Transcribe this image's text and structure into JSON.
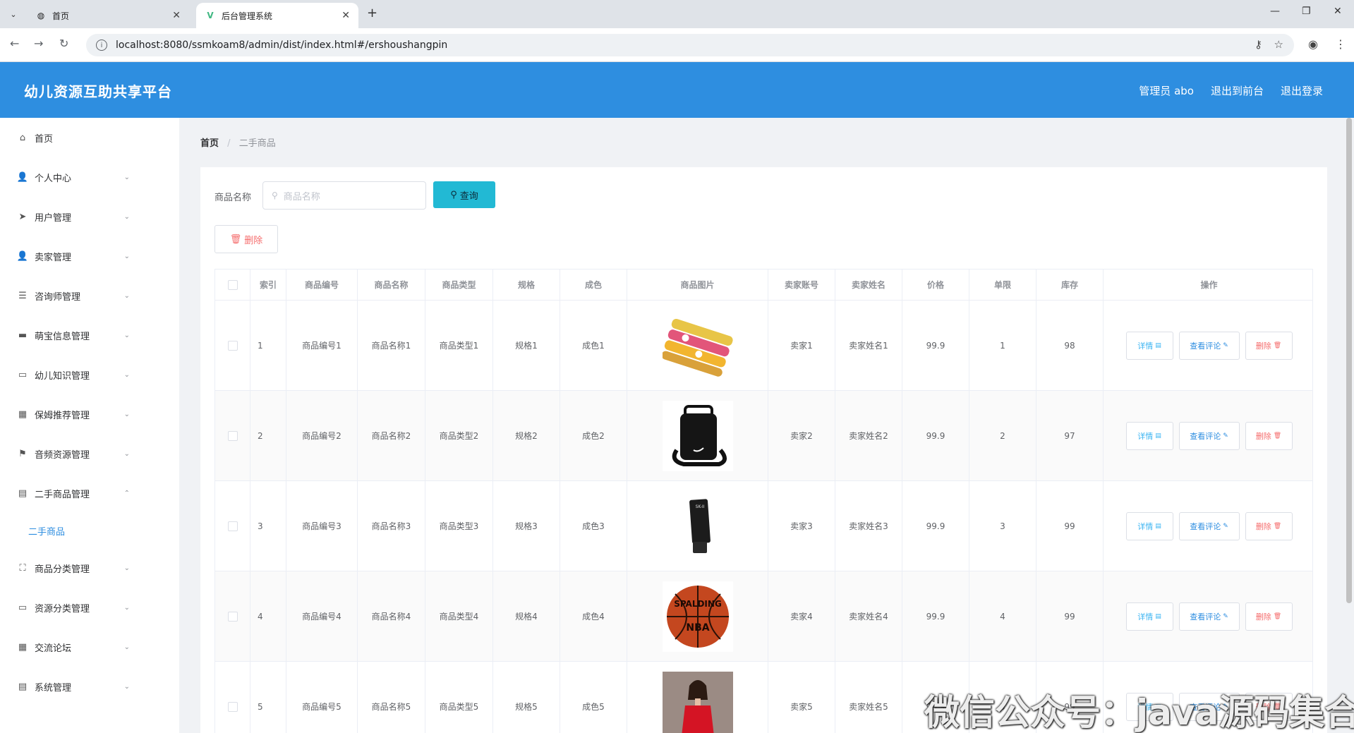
{
  "browser": {
    "tabs": [
      {
        "title": "首页"
      },
      {
        "title": "后台管理系统"
      }
    ],
    "url": "localhost:8080/ssmkoam8/admin/dist/index.html#/ershoushangpin"
  },
  "header": {
    "title": "幼儿资源互助共享平台",
    "admin_label": "管理员 abo",
    "to_front": "退出到前台",
    "logout": "退出登录",
    "color": "#2e8ee0"
  },
  "sidebar": {
    "items": [
      {
        "label": "首页",
        "icon": "home-icon",
        "glyph": "⌂",
        "expanded": false,
        "has_arrow": false
      },
      {
        "label": "个人中心",
        "icon": "user-icon",
        "glyph": "👤",
        "has_arrow": true
      },
      {
        "label": "用户管理",
        "icon": "send-icon",
        "glyph": "➤",
        "has_arrow": true
      },
      {
        "label": "卖家管理",
        "icon": "user-icon",
        "glyph": "👤",
        "has_arrow": true
      },
      {
        "label": "咨询师管理",
        "icon": "list-icon",
        "glyph": "☰",
        "has_arrow": true
      },
      {
        "label": "萌宝信息管理",
        "icon": "chat-icon",
        "glyph": "▬",
        "has_arrow": true
      },
      {
        "label": "幼儿知识管理",
        "icon": "monitor-icon",
        "glyph": "▭",
        "has_arrow": true
      },
      {
        "label": "保姆推荐管理",
        "icon": "grid-icon",
        "glyph": "▦",
        "has_arrow": true
      },
      {
        "label": "音频资源管理",
        "icon": "flag-icon",
        "glyph": "⚑",
        "has_arrow": true
      },
      {
        "label": "二手商品管理",
        "icon": "document-icon",
        "glyph": "▤",
        "has_arrow": true,
        "expanded": true
      },
      {
        "label": "商品分类管理",
        "icon": "fullscreen-icon",
        "glyph": "⛶",
        "has_arrow": true
      },
      {
        "label": "资源分类管理",
        "icon": "message-icon",
        "glyph": "▭",
        "has_arrow": true
      },
      {
        "label": "交流论坛",
        "icon": "menu-icon",
        "glyph": "▦",
        "has_arrow": true
      },
      {
        "label": "系统管理",
        "icon": "setting-icon",
        "glyph": "▤",
        "has_arrow": true
      }
    ],
    "active_sub": "二手商品"
  },
  "breadcrumb": {
    "home": "首页",
    "current": "二手商品"
  },
  "search": {
    "label": "商品名称",
    "placeholder": "商品名称",
    "button": "查询"
  },
  "toolbar": {
    "delete": "删除"
  },
  "table": {
    "headers": [
      "",
      "索引",
      "商品编号",
      "商品名称",
      "商品类型",
      "规格",
      "成色",
      "商品图片",
      "卖家账号",
      "卖家姓名",
      "价格",
      "单限",
      "库存",
      "操作"
    ],
    "rows": [
      {
        "index": "1",
        "code": "商品编号1",
        "name": "商品名称1",
        "type": "商品类型1",
        "spec": "规格1",
        "cond": "成色1",
        "image": "snack-tubes",
        "account": "卖家1",
        "seller": "卖家姓名1",
        "price": "99.9",
        "limit": "1",
        "stock": "98"
      },
      {
        "index": "2",
        "code": "商品编号2",
        "name": "商品名称2",
        "type": "商品类型2",
        "spec": "规格2",
        "cond": "成色2",
        "image": "black-bag",
        "account": "卖家2",
        "seller": "卖家姓名2",
        "price": "99.9",
        "limit": "2",
        "stock": "97"
      },
      {
        "index": "3",
        "code": "商品编号3",
        "name": "商品名称3",
        "type": "商品类型3",
        "spec": "规格3",
        "cond": "成色3",
        "image": "cosmetic-tube",
        "account": "卖家3",
        "seller": "卖家姓名3",
        "price": "99.9",
        "limit": "3",
        "stock": "99"
      },
      {
        "index": "4",
        "code": "商品编号4",
        "name": "商品名称4",
        "type": "商品类型4",
        "spec": "规格4",
        "cond": "成色4",
        "image": "basketball",
        "account": "卖家4",
        "seller": "卖家姓名4",
        "price": "99.9",
        "limit": "4",
        "stock": "99"
      },
      {
        "index": "5",
        "code": "商品编号5",
        "name": "商品名称5",
        "type": "商品类型5",
        "spec": "规格5",
        "cond": "成色5",
        "image": "red-dress",
        "account": "卖家5",
        "seller": "卖家姓名5",
        "price": "99.9",
        "limit": "5",
        "stock": "99"
      }
    ],
    "actions": {
      "detail": "详情",
      "comments": "查看评论",
      "delete": "删除"
    }
  },
  "watermark": "微信公众号：java源码集合"
}
